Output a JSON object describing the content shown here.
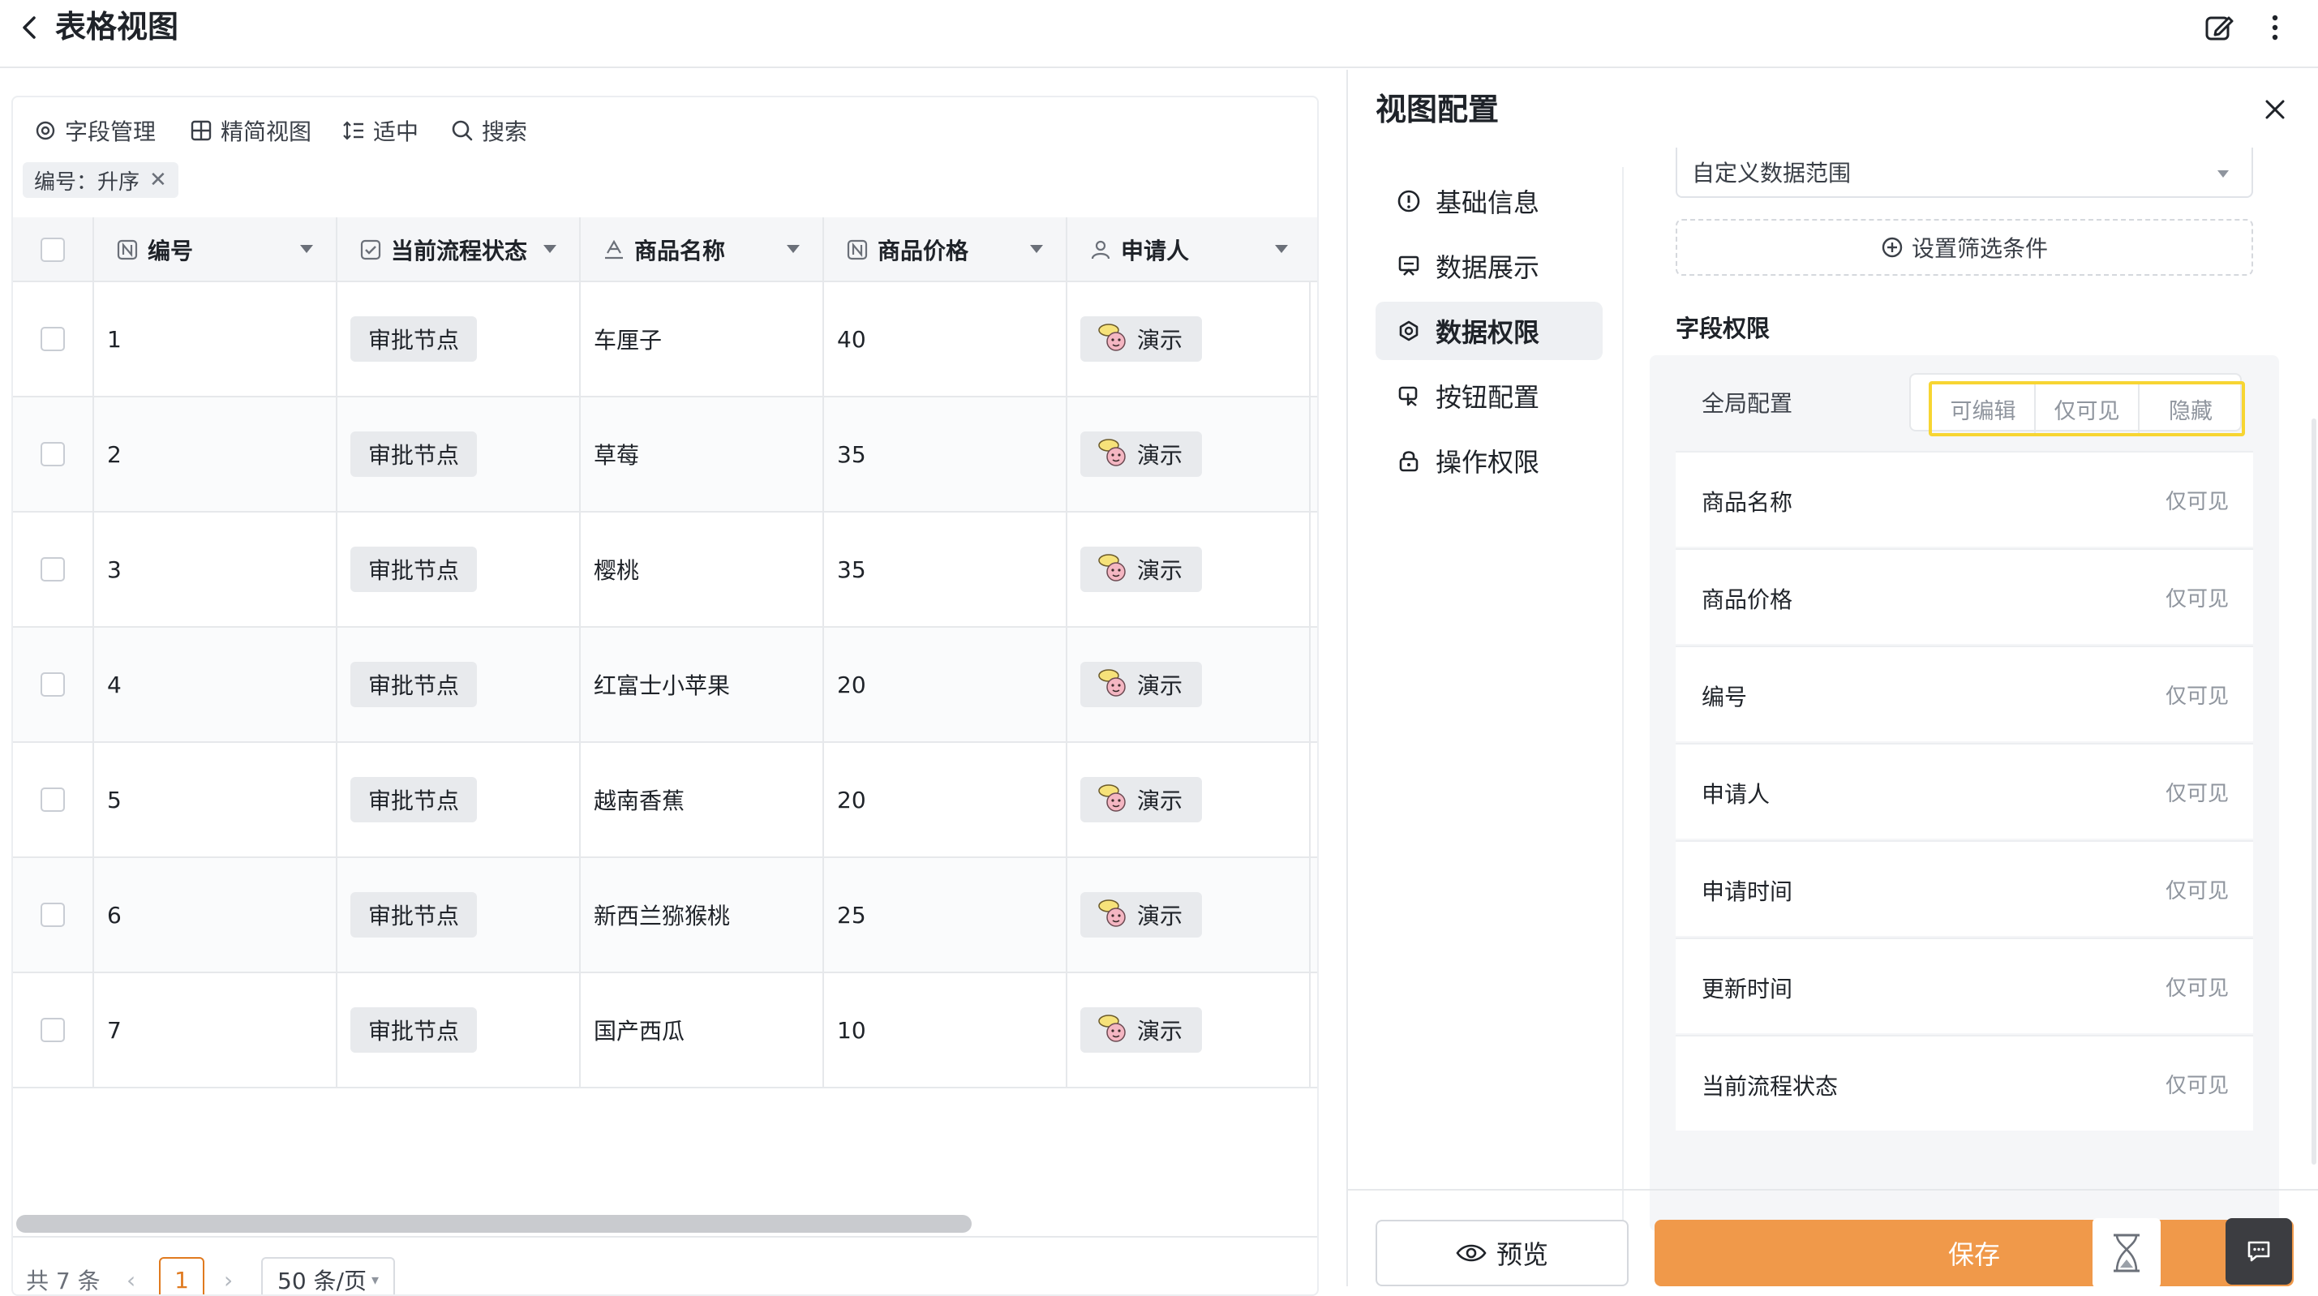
{
  "header": {
    "title": "表格视图"
  },
  "toolbar": {
    "field_manage": "字段管理",
    "compact_view": "精简视图",
    "density": "适中",
    "search": "搜索"
  },
  "sort_tag": {
    "label": "编号：升序"
  },
  "columns": [
    {
      "label": "编号",
      "icon": "number-field-icon"
    },
    {
      "label": "当前流程状态",
      "icon": "checkbox-field-icon"
    },
    {
      "label": "商品名称",
      "icon": "text-field-icon"
    },
    {
      "label": "商品价格",
      "icon": "number-field-icon"
    },
    {
      "label": "申请人",
      "icon": "person-field-icon"
    }
  ],
  "rows": [
    {
      "id": "1",
      "status": "审批节点",
      "name": "车厘子",
      "price": "40",
      "user": "演示"
    },
    {
      "id": "2",
      "status": "审批节点",
      "name": "草莓",
      "price": "35",
      "user": "演示"
    },
    {
      "id": "3",
      "status": "审批节点",
      "name": "樱桃",
      "price": "35",
      "user": "演示"
    },
    {
      "id": "4",
      "status": "审批节点",
      "name": "红富士小苹果",
      "price": "20",
      "user": "演示"
    },
    {
      "id": "5",
      "status": "审批节点",
      "name": "越南香蕉",
      "price": "20",
      "user": "演示"
    },
    {
      "id": "6",
      "status": "审批节点",
      "name": "新西兰猕猴桃",
      "price": "25",
      "user": "演示"
    },
    {
      "id": "7",
      "status": "审批节点",
      "name": "国产西瓜",
      "price": "10",
      "user": "演示"
    }
  ],
  "pager": {
    "total": "共 7 条",
    "current_page": "1",
    "page_size": "50 条/页"
  },
  "panel": {
    "title": "视图配置",
    "nav": [
      {
        "label": "基础信息",
        "icon": "info-icon"
      },
      {
        "label": "数据展示",
        "icon": "display-icon"
      },
      {
        "label": "数据权限",
        "icon": "permission-icon",
        "active": true
      },
      {
        "label": "按钮配置",
        "icon": "button-config-icon"
      },
      {
        "label": "操作权限",
        "icon": "lock-icon"
      }
    ],
    "data_range": "自定义数据范围",
    "add_filter": "设置筛选条件",
    "field_perm_title": "字段权限",
    "global_label": "全局配置",
    "segments": [
      "可编辑",
      "仅可见",
      "隐藏"
    ],
    "fields": [
      {
        "name": "商品名称",
        "value": "仅可见"
      },
      {
        "name": "商品价格",
        "value": "仅可见"
      },
      {
        "name": "编号",
        "value": "仅可见"
      },
      {
        "name": "申请人",
        "value": "仅可见"
      },
      {
        "name": "申请时间",
        "value": "仅可见"
      },
      {
        "name": "更新时间",
        "value": "仅可见"
      },
      {
        "name": "当前流程状态",
        "value": "仅可见"
      }
    ],
    "preview": "预览",
    "save": "保存"
  },
  "colors": {
    "accent": "#f0994a",
    "highlight": "#f7d532",
    "pager_active": "#e07a1f"
  }
}
